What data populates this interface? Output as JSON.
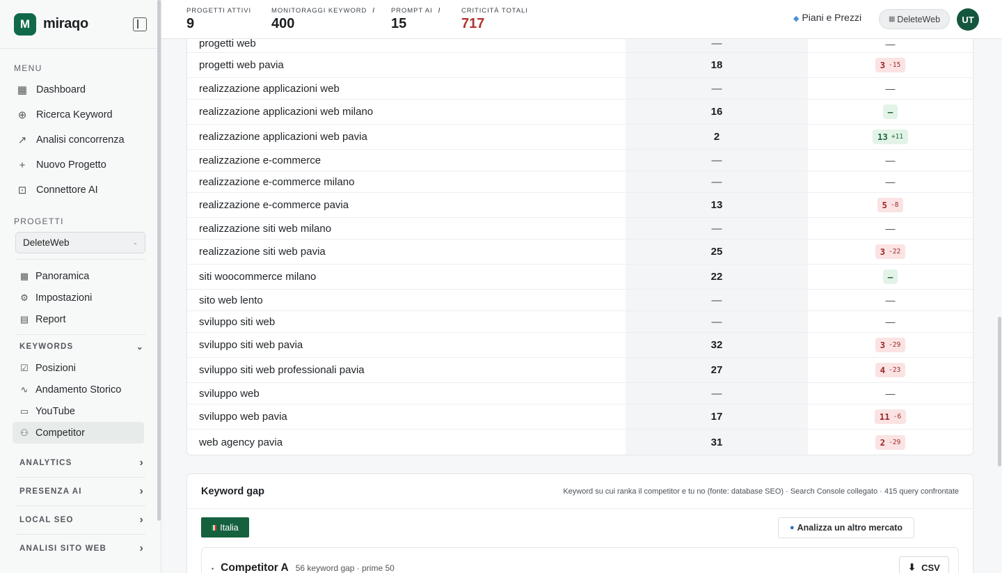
{
  "brand": {
    "name": "miraqo",
    "mark": "M"
  },
  "sidebar": {
    "menu_label": "MENU",
    "menu": [
      {
        "label": "Dashboard",
        "icon": "▦",
        "name": "dashboard"
      },
      {
        "label": "Ricerca Keyword",
        "icon": "⊕",
        "name": "ricerca-keyword"
      },
      {
        "label": "Analisi concorrenza",
        "icon": "↗",
        "name": "analisi-concorrenza"
      },
      {
        "label": "Nuovo Progetto",
        "icon": "+",
        "name": "nuovo-progetto"
      },
      {
        "label": "Connettore AI",
        "icon": "⊡",
        "name": "connettore-ai"
      }
    ],
    "projects_label": "PROGETTI",
    "selected_project": "DeleteWeb",
    "project_items": [
      {
        "label": "Panoramica",
        "icon": "▦"
      },
      {
        "label": "Impostazioni",
        "icon": "⚙"
      },
      {
        "label": "Report",
        "icon": "▤"
      }
    ],
    "keywords_group": "KEYWORDS",
    "keyword_items": [
      {
        "label": "Posizioni",
        "icon": "☑"
      },
      {
        "label": "Andamento Storico",
        "icon": "∿"
      },
      {
        "label": "YouTube",
        "icon": "▭"
      },
      {
        "label": "Competitor",
        "icon": "⚇"
      }
    ],
    "groups": [
      "ANALYTICS",
      "PRESENZA AI",
      "LOCAL SEO",
      "ANALISI SITO WEB"
    ]
  },
  "header": {
    "stats": [
      {
        "label": "PROGETTI ATTIVI",
        "value": "9",
        "info": ""
      },
      {
        "label": "MONITORAGGI KEYWORD",
        "value": "400",
        "info": "i"
      },
      {
        "label": "PROMPT AI",
        "value": "15",
        "info": "i"
      },
      {
        "label": "CRITICITÀ TOTALI",
        "value": "717",
        "info": ""
      }
    ],
    "plans": "Piani e Prezzi",
    "project_pill": "DeleteWeb",
    "avatar": "UT"
  },
  "rows": [
    {
      "kw": "progetti web",
      "pos": "—",
      "comp": "—",
      "delta": "",
      "tone": ""
    },
    {
      "kw": "progetti web pavia",
      "pos": "18",
      "comp": "3",
      "delta": "-15",
      "tone": "red"
    },
    {
      "kw": "realizzazione applicazioni web",
      "pos": "—",
      "comp": "—",
      "delta": "",
      "tone": ""
    },
    {
      "kw": "realizzazione applicazioni web milano",
      "pos": "16",
      "comp": "–",
      "delta": "",
      "tone": "green"
    },
    {
      "kw": "realizzazione applicazioni web pavia",
      "pos": "2",
      "comp": "13",
      "delta": "+11",
      "tone": "green"
    },
    {
      "kw": "realizzazione e-commerce",
      "pos": "—",
      "comp": "—",
      "delta": "",
      "tone": ""
    },
    {
      "kw": "realizzazione e-commerce milano",
      "pos": "—",
      "comp": "—",
      "delta": "",
      "tone": ""
    },
    {
      "kw": "realizzazione e-commerce pavia",
      "pos": "13",
      "comp": "5",
      "delta": "-8",
      "tone": "red"
    },
    {
      "kw": "realizzazione siti web milano",
      "pos": "—",
      "comp": "—",
      "delta": "",
      "tone": ""
    },
    {
      "kw": "realizzazione siti web pavia",
      "pos": "25",
      "comp": "3",
      "delta": "-22",
      "tone": "red"
    },
    {
      "kw": "siti woocommerce milano",
      "pos": "22",
      "comp": "–",
      "delta": "",
      "tone": "green"
    },
    {
      "kw": "sito web lento",
      "pos": "—",
      "comp": "—",
      "delta": "",
      "tone": ""
    },
    {
      "kw": "sviluppo siti web",
      "pos": "—",
      "comp": "—",
      "delta": "",
      "tone": ""
    },
    {
      "kw": "sviluppo siti web pavia",
      "pos": "32",
      "comp": "3",
      "delta": "-29",
      "tone": "red"
    },
    {
      "kw": "sviluppo siti web professionali pavia",
      "pos": "27",
      "comp": "4",
      "delta": "-23",
      "tone": "red"
    },
    {
      "kw": "sviluppo web",
      "pos": "—",
      "comp": "—",
      "delta": "",
      "tone": ""
    },
    {
      "kw": "sviluppo web pavia",
      "pos": "17",
      "comp": "11",
      "delta": "-6",
      "tone": "red"
    },
    {
      "kw": "web agency pavia",
      "pos": "31",
      "comp": "2",
      "delta": "-29",
      "tone": "red"
    }
  ],
  "gap": {
    "title": "Keyword gap",
    "description": "Keyword su cui ranka il competitor e tu no (fonte: database SEO) · Search Console collegato · 415 query confrontate",
    "market": "Italia",
    "other_market": "Analizza un altro mercato",
    "competitor": "Competitor A",
    "competitor_meta": "56 keyword gap · prime 50",
    "csv": "CSV"
  },
  "colors": {
    "brand": "#106a4a",
    "danger": "#b1322f",
    "badge_red": "#fbe3e3",
    "badge_green": "#e3f3e8"
  }
}
